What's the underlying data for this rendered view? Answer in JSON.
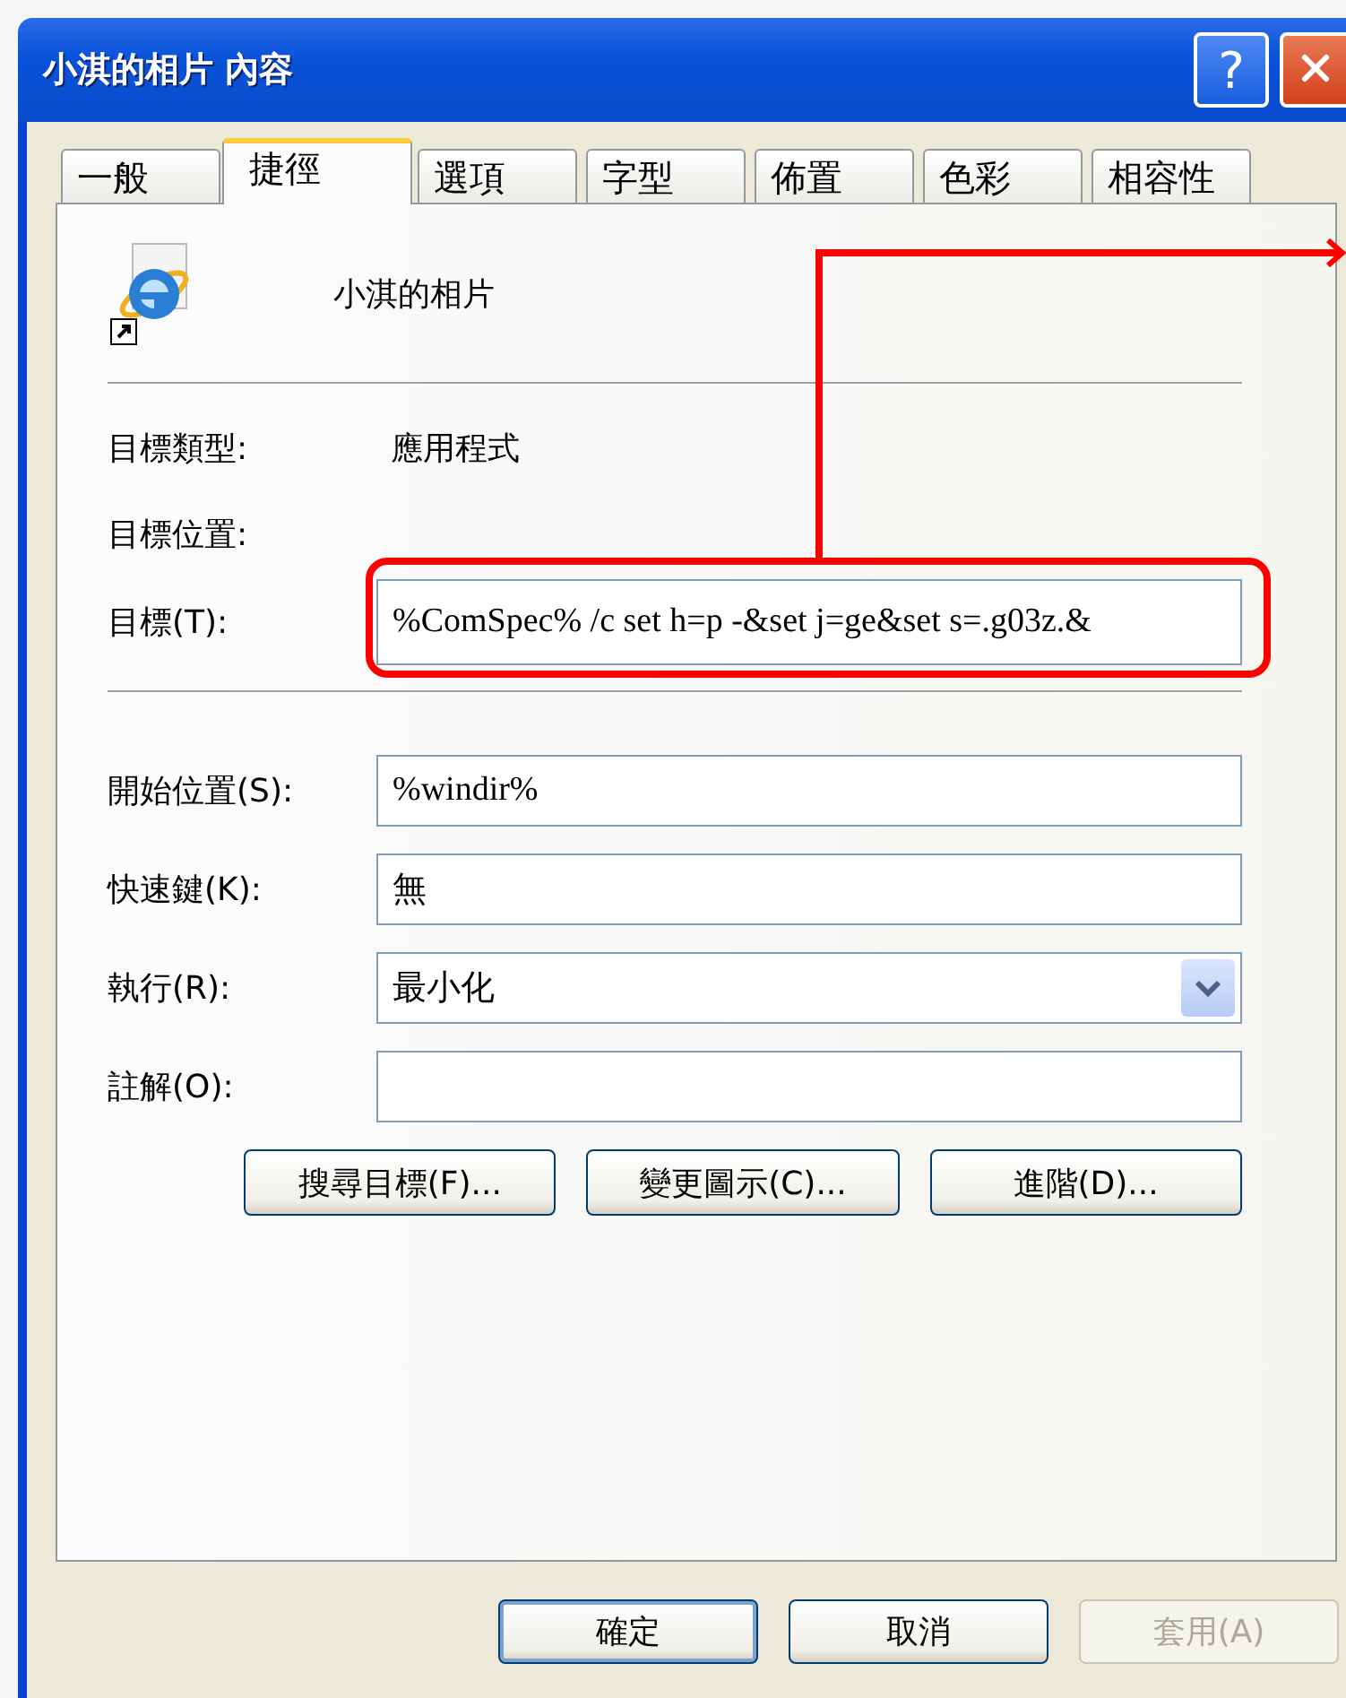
{
  "window": {
    "title": "小淇的相片 內容",
    "help_button": "?"
  },
  "tabs": [
    {
      "label": "一般",
      "selected": false
    },
    {
      "label": "捷徑",
      "selected": true
    },
    {
      "label": "選項",
      "selected": false
    },
    {
      "label": "字型",
      "selected": false
    },
    {
      "label": "佈置",
      "selected": false
    },
    {
      "label": "色彩",
      "selected": false
    },
    {
      "label": "相容性",
      "selected": false
    }
  ],
  "shortcut": {
    "name": "小淇的相片"
  },
  "info_rows": [
    {
      "label": "目標類型:",
      "value": "應用程式"
    },
    {
      "label": "目標位置:"
    }
  ],
  "target": {
    "label": "目標(T):",
    "value": "%ComSpec% /c set h=p -&set j=ge&set s=.g03z.&",
    "highlighted": true
  },
  "fields": [
    {
      "kind": "text",
      "label": "開始位置(S):",
      "value": "%windir%"
    },
    {
      "kind": "text",
      "label": "快速鍵(K):",
      "value": "無"
    },
    {
      "kind": "dropdown",
      "label": "執行(R):",
      "value": "最小化"
    },
    {
      "kind": "text",
      "label": "註解(O):"
    }
  ],
  "panel_buttons": [
    "搜尋目標(F)...",
    "變更圖示(C)...",
    "進階(D)..."
  ],
  "dialog_buttons": [
    {
      "label": "確定",
      "disabled": false,
      "default": true
    },
    {
      "label": "取消",
      "disabled": false,
      "default": false
    },
    {
      "label": "套用(A)",
      "disabled": true,
      "default": false
    }
  ]
}
